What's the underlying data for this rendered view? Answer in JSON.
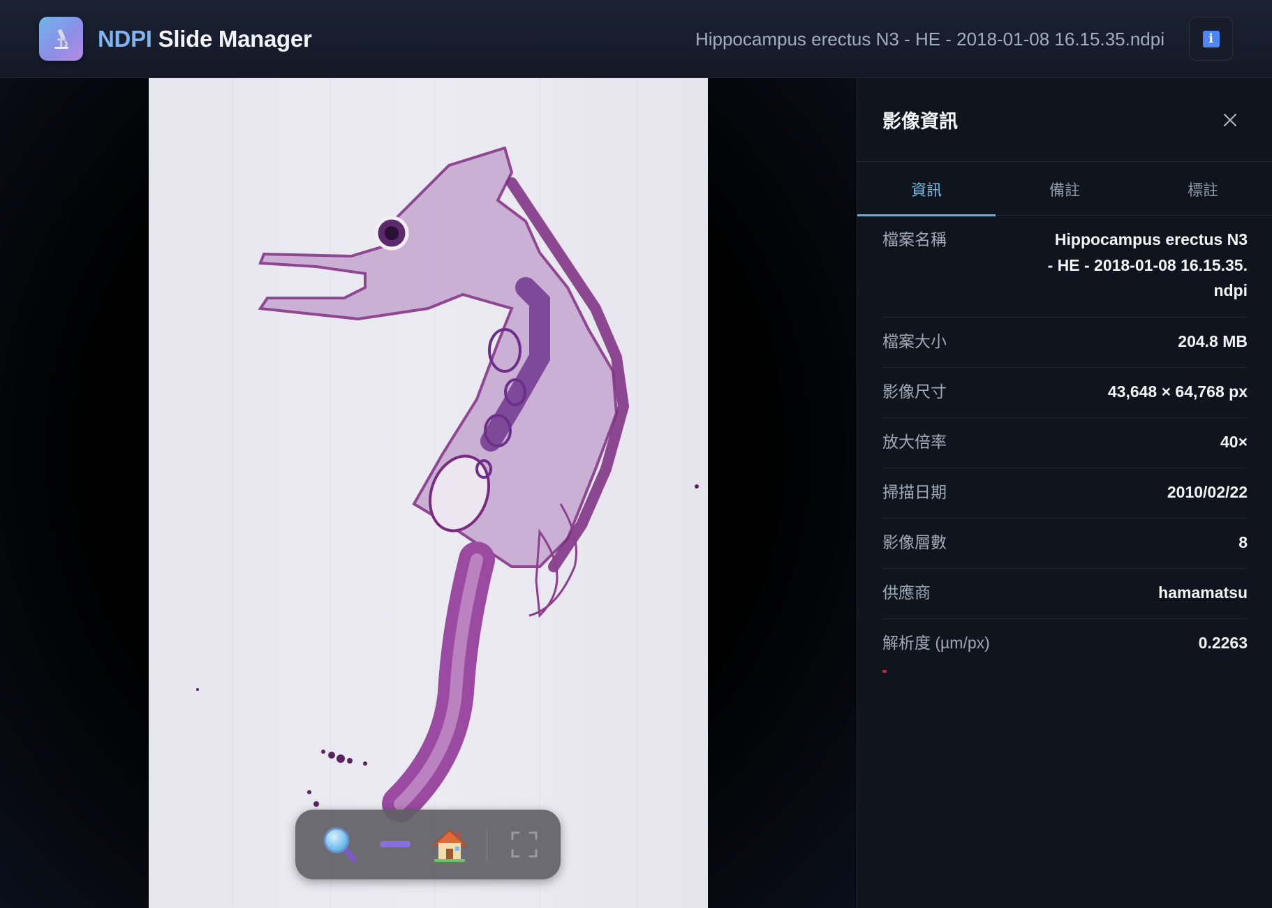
{
  "header": {
    "brand": "NDPI",
    "title_rest": "Slide Manager",
    "logo_icon": "microscope-icon",
    "file_name": "Hippocampus erectus N3 - HE - 2018-01-08 16.15.35.ndpi",
    "info_icon": "info-icon"
  },
  "viewer": {
    "toolbar": {
      "zoom_in": "magnifier-icon",
      "zoom_out": "minus-icon",
      "home": "house-icon",
      "fullscreen": "fullscreen-icon"
    }
  },
  "panel": {
    "title": "影像資訊",
    "tabs": [
      {
        "label": "資訊",
        "active": true
      },
      {
        "label": "備註",
        "active": false
      },
      {
        "label": "標註",
        "active": false
      }
    ],
    "info": [
      {
        "label": "檔案名稱",
        "value": "Hippocampus erectus N3 - HE - 2018-01-08 16.15.35.ndpi"
      },
      {
        "label": "檔案大小",
        "value": "204.8 MB"
      },
      {
        "label": "影像尺寸",
        "value": "43,648 × 64,768 px"
      },
      {
        "label": "放大倍率",
        "value": "40×"
      },
      {
        "label": "掃描日期",
        "value": "2010/02/22"
      },
      {
        "label": "影像層數",
        "value": "8"
      },
      {
        "label": "供應商",
        "value": "hamamatsu"
      },
      {
        "label": "解析度 (µm/px)",
        "value": "0.2263"
      }
    ]
  },
  "colors": {
    "accent": "#56b4e4",
    "brand": "#7fb4f0",
    "tissue": "#8b3f8e"
  }
}
